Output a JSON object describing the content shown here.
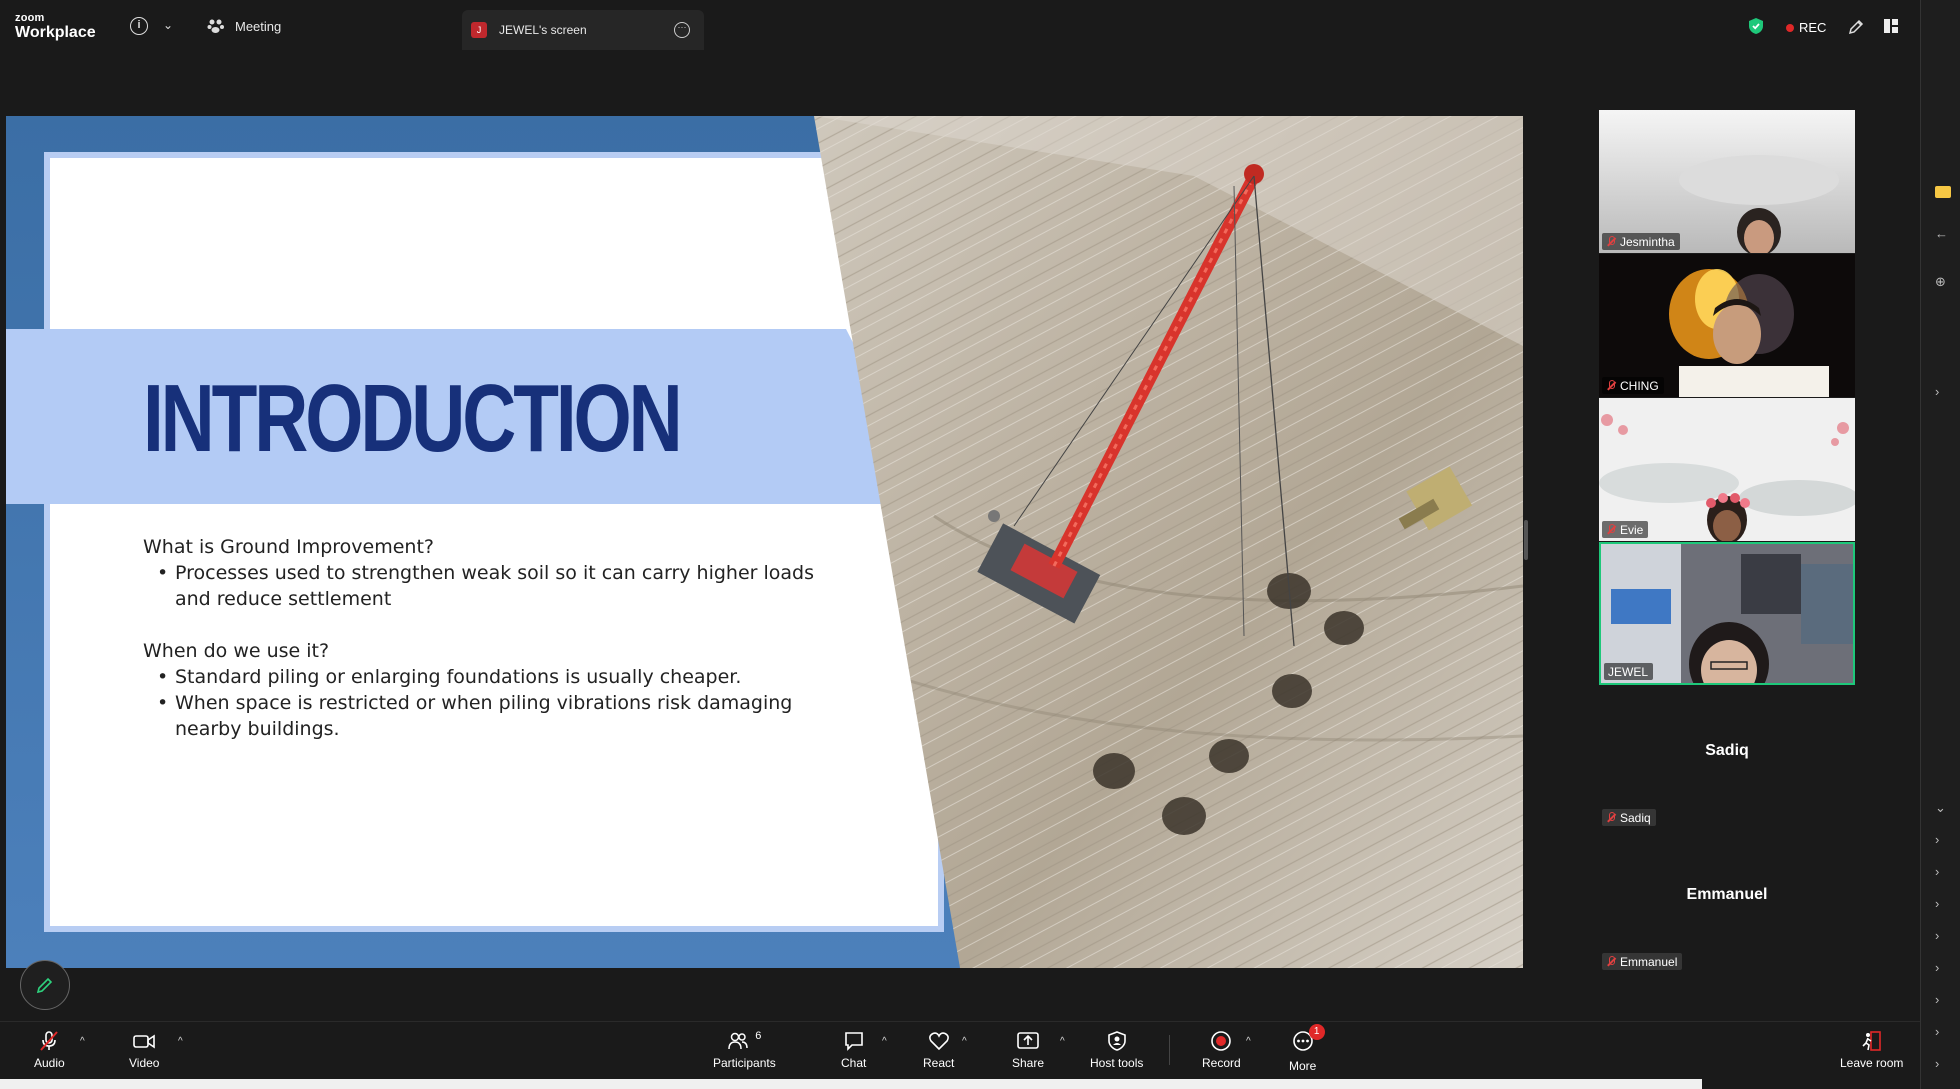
{
  "topbar": {
    "logo_small": "zoom",
    "logo_big": "Workplace",
    "meeting_label": "Meeting",
    "screen_badge": "J",
    "screen_label": "JEWEL's screen",
    "rec_label": "REC"
  },
  "slide": {
    "title": "INTRODUCTION",
    "q1": "What is Ground Improvement?",
    "q1_points": [
      "Processes used to strengthen weak soil so it can carry higher loads and reduce settlement"
    ],
    "q2": "When do we use it?",
    "q2_points": [
      "Standard piling or enlarging foundations is usually cheaper.",
      "When space is restricted or when piling vibrations risk damaging nearby buildings."
    ]
  },
  "participants": {
    "video_tiles": [
      {
        "name": "Jesmintha",
        "muted": true
      },
      {
        "name": "CHING",
        "muted": true
      },
      {
        "name": "Evie",
        "muted": true
      },
      {
        "name": "JEWEL",
        "muted": false,
        "active": true
      }
    ],
    "name_tiles": [
      {
        "display": "Sadiq",
        "label": "Sadiq"
      },
      {
        "display": "Emmanuel",
        "label": "Emmanuel"
      }
    ]
  },
  "toolbar": {
    "audio": "Audio",
    "video": "Video",
    "participants": "Participants",
    "participants_count": "6",
    "chat": "Chat",
    "react": "React",
    "share": "Share",
    "host_tools": "Host tools",
    "record": "Record",
    "more": "More",
    "more_badge": "1",
    "leave": "Leave room"
  },
  "colors": {
    "accent_green": "#1ec87a",
    "record_red": "#e02828",
    "slide_title": "#17307a",
    "slide_band": "#b3cbf5"
  }
}
